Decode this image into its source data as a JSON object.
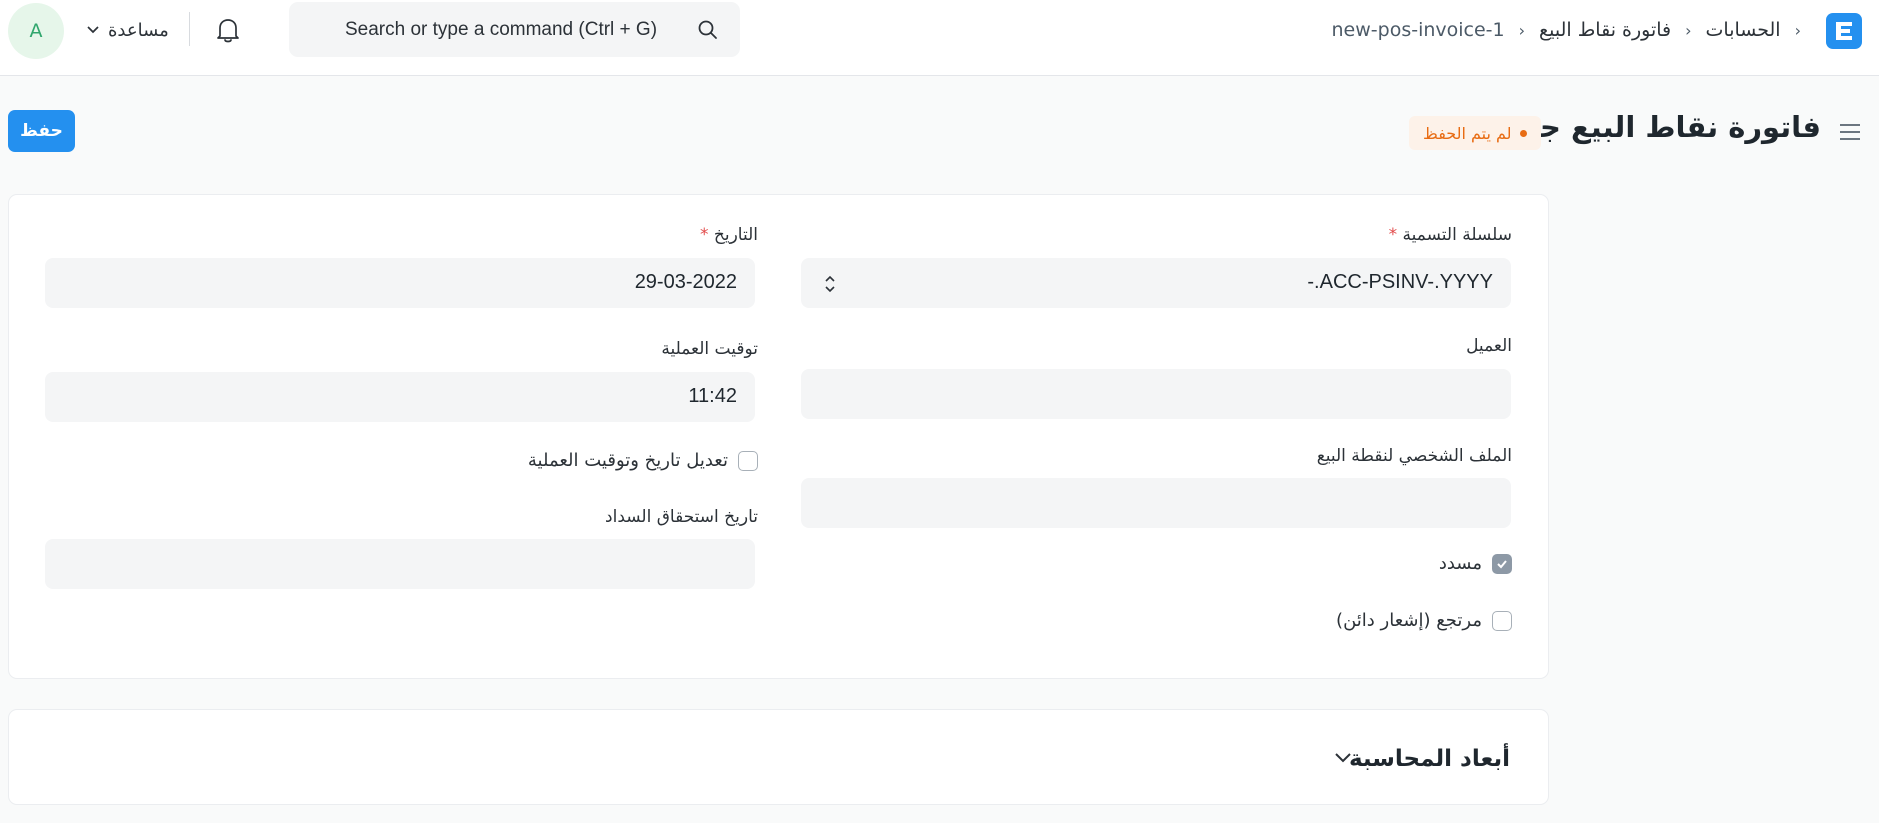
{
  "navbar": {
    "breadcrumbs": [
      "الحسابات",
      "فاتورة نقاط البيع",
      "new-pos-invoice-1"
    ],
    "search_placeholder": "Search or type a command (Ctrl + G)",
    "help_label": "مساعدة",
    "avatar_initial": "A"
  },
  "page": {
    "title": "فاتورة نقاط البيع جديد",
    "status": "لم يتم الحفظ",
    "save_label": "حفظ"
  },
  "form": {
    "naming_series": {
      "label": "سلسلة التسمية",
      "required_mark": "*",
      "value": "-.ACC-PSINV-.YYYY"
    },
    "customer": {
      "label": "العميل",
      "value": ""
    },
    "pos_profile": {
      "label": "الملف الشخصي لنقطة البيع",
      "value": ""
    },
    "is_paid": {
      "label": "مسدد",
      "checked": true
    },
    "is_return": {
      "label": "مرتجع (إشعار دائن)",
      "checked": false
    },
    "posting_date": {
      "label": "التاريخ",
      "required_mark": "*",
      "value": "29-03-2022"
    },
    "posting_time": {
      "label": "توقيت العملية",
      "value": "11:42"
    },
    "set_posting_time": {
      "label": "تعديل تاريخ وتوقيت العملية",
      "checked": false
    },
    "due_date": {
      "label": "تاريخ استحقاق السداد",
      "value": ""
    }
  },
  "accounting_dimensions": {
    "title": "أبعاد المحاسبة"
  },
  "colors": {
    "primary": "#2490ef",
    "status_orange": "#e86c13",
    "status_bg": "#fdf2e9",
    "avatar_green": "#30a66d",
    "field_bg": "#f4f5f6"
  },
  "icons": [
    "erpnext-logo-icon",
    "chevron-right-icon",
    "search-icon",
    "bell-icon",
    "chevron-down-icon",
    "hamburger-menu-icon",
    "select-arrows-icon",
    "check-icon"
  ]
}
